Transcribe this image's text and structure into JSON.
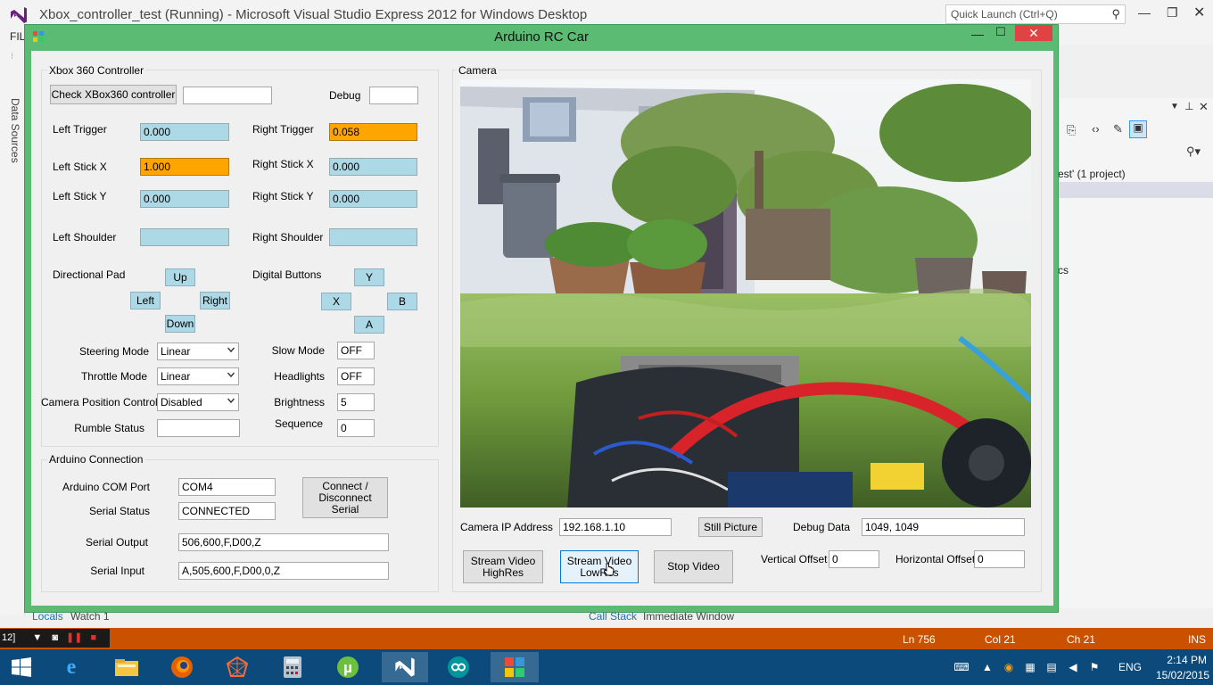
{
  "vs": {
    "title": "Xbox_controller_test (Running) - Microsoft Visual Studio Express 2012 for Windows Desktop",
    "quick_launch_placeholder": "Quick Launch (Ctrl+Q)",
    "menu_file": "FIL",
    "data_sources": "Data Sources",
    "solution_text": "est' (1 project)",
    "cs_text": "cs",
    "bottom_tabs": {
      "locals": "Locals",
      "watch": "Watch 1",
      "call_stack": "Call Stack",
      "immediate": "Immediate Window"
    },
    "status": {
      "left": "12]",
      "ln": "Ln 756",
      "col": "Col 21",
      "ch": "Ch 21",
      "ins": "INS"
    }
  },
  "taskbar": {
    "language": "ENG",
    "time": "2:14 PM",
    "date": "15/02/2015"
  },
  "app": {
    "title": "Arduino RC Car",
    "xbox_group": {
      "title": "Xbox 360 Controller",
      "check_button": "Check XBox360 controller",
      "check_status": "",
      "debug_label": "Debug",
      "debug_value": "",
      "left_trigger_label": "Left Trigger",
      "left_trigger_value": "0.000",
      "right_trigger_label": "Right Trigger",
      "right_trigger_value": "0.058",
      "left_stick_x_label": "Left Stick X",
      "left_stick_x_value": "1.000",
      "right_stick_x_label": "Right Stick X",
      "right_stick_x_value": "0.000",
      "left_stick_y_label": "Left Stick Y",
      "left_stick_y_value": "0.000",
      "right_stick_y_label": "Right Stick Y",
      "right_stick_y_value": "0.000",
      "left_shoulder_label": "Left Shoulder",
      "left_shoulder_value": "",
      "right_shoulder_label": "Right Shoulder",
      "right_shoulder_value": "",
      "dpad_label": "Directional Pad",
      "dpad_up": "Up",
      "dpad_left": "Left",
      "dpad_right": "Right",
      "dpad_down": "Down",
      "digital_label": "Digital Buttons",
      "btn_y": "Y",
      "btn_x": "X",
      "btn_b": "B",
      "btn_a": "A",
      "steering_mode_label": "Steering Mode",
      "steering_mode_value": "Linear",
      "throttle_mode_label": "Throttle Mode",
      "throttle_mode_value": "Linear",
      "camera_position_label": "Camera Position Control",
      "camera_position_value": "Disabled",
      "rumble_label": "Rumble Status",
      "rumble_value": "",
      "slow_mode_label": "Slow Mode",
      "slow_mode_value": "OFF",
      "headlights_label": "Headlights",
      "headlights_value": "OFF",
      "brightness_label": "Brightness",
      "brightness_value": "5",
      "sequence_label": "Sequence",
      "sequence_value": "0"
    },
    "arduino_group": {
      "title": "Arduino Connection",
      "com_port_label": "Arduino COM Port",
      "com_port_value": "COM4",
      "serial_status_label": "Serial Status",
      "serial_status_value": "CONNECTED",
      "connect_button": "Connect / Disconnect Serial",
      "serial_output_label": "Serial Output",
      "serial_output_value": "506,600,F,D00,Z",
      "serial_input_label": "Serial Input",
      "serial_input_value": "A,505,600,F,D00,0,Z"
    },
    "camera_group": {
      "title": "Camera",
      "ip_label": "Camera IP Address",
      "ip_value": "192.168.1.10",
      "still_button": "Still Picture",
      "debug_data_label": "Debug Data",
      "debug_data_value": "1049, 1049",
      "stream_high_button": "Stream Video HighRes",
      "stream_low_button": "Stream Video LowRes",
      "stop_button": "Stop Video",
      "vertical_offset_label": "Vertical Offset",
      "vertical_offset_value": "0",
      "horizontal_offset_label": "Horizontal Offset",
      "horizontal_offset_value": "0"
    }
  },
  "colors": {
    "window_frame": "#5bbb73",
    "highlight_blue": "#add8e6",
    "highlight_orange": "#ffa500",
    "status_bar": "#ca5100",
    "taskbar": "#0b4a7a"
  }
}
